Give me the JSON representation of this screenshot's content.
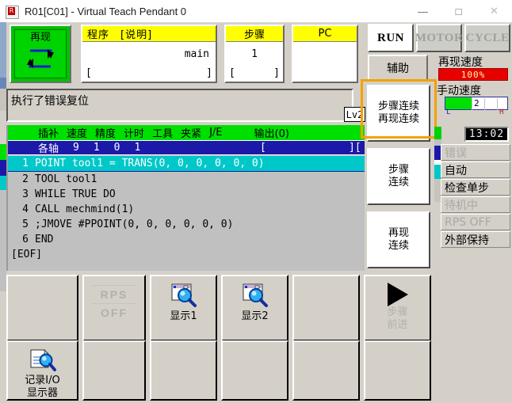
{
  "window": {
    "title": "R01[C01] - Virtual Teach Pendant 0",
    "icon": "robot-app-icon",
    "minimize": "—",
    "maximize": "□",
    "close": "✕"
  },
  "mode_button": {
    "label": "再现",
    "icon": "cycle-arrows-icon",
    "color": "#00c000"
  },
  "panels": {
    "program": {
      "header": "程序　[说明]",
      "value": "main",
      "bracket_left": "[",
      "bracket_right": "]"
    },
    "step": {
      "header": "步骤",
      "value": "1",
      "bracket_left": "[",
      "bracket_right": "]"
    },
    "pc": {
      "header": "PC",
      "value": "",
      "bracket_left": "",
      "bracket_right": ""
    }
  },
  "state_buttons": [
    {
      "label": "RUN",
      "active": true
    },
    {
      "label": "MOTOR",
      "active": false
    },
    {
      "label": "CYCLE",
      "active": false
    }
  ],
  "aux_button": {
    "label": "辅助"
  },
  "speed": {
    "replay_label": "再现速度",
    "replay_value": "100%",
    "replay_color": "#e60000",
    "manual_label": "手动速度",
    "manual_value": "2",
    "manual_color": "#00e000",
    "low_mark": "L",
    "high_mark": "H"
  },
  "clock": {
    "time": "13:02"
  },
  "message_bar": {
    "text": "执行了错误复位",
    "level_badge": "Lv2"
  },
  "code_view": {
    "columns": [
      "插补",
      "速度",
      "精度",
      "计时",
      "工具",
      "夹紧",
      "J/E"
    ],
    "columns_output": "输出(0)",
    "values": [
      "各轴",
      "9",
      "1",
      "0",
      "1"
    ],
    "bracket_1": "[",
    "bracket_2": "][",
    "lines": [
      {
        "no": "1",
        "text": "POINT tool1 = TRANS(0, 0, 0, 0, 0, 0)",
        "selected": true
      },
      {
        "no": "2",
        "text": "TOOL tool1",
        "selected": false
      },
      {
        "no": "3",
        "text": "WHILE TRUE DO",
        "selected": false
      },
      {
        "no": "4",
        "text": "CALL mechmind(1)",
        "selected": false
      },
      {
        "no": "5",
        "text": ";JMOVE #PPOINT(0, 0, 0, 0, 0, 0)",
        "selected": false
      },
      {
        "no": "6",
        "text": "END",
        "selected": false
      }
    ],
    "eof": "[EOF]",
    "selected_color": "#00c8c8",
    "header_color": "#00e000",
    "subheader_color": "#1c18a8"
  },
  "continuous_buttons": [
    {
      "line1": "步骤连续",
      "line2": "再现连续",
      "highlighted": true
    },
    {
      "line1": "步骤",
      "line2": "连续",
      "highlighted": false
    },
    {
      "line1": "再现",
      "line2": "连续",
      "highlighted": false
    }
  ],
  "highlight_color": "#f5a000",
  "status_list": [
    {
      "label": "错误",
      "enabled": false
    },
    {
      "label": "自动",
      "enabled": true
    },
    {
      "label": "检查单步",
      "enabled": true
    },
    {
      "label": "待机中",
      "enabled": false
    },
    {
      "label": "RPS OFF",
      "enabled": false
    },
    {
      "label": "外部保持",
      "enabled": true
    }
  ],
  "function_keys": [
    {
      "id": "key-blank-1",
      "icon": "",
      "line1": "",
      "line2": "",
      "enabled": true
    },
    {
      "id": "key-rps-off",
      "icon": "rps-off-icon",
      "line1": "RPS",
      "line2": "OFF",
      "enabled": false
    },
    {
      "id": "key-display1",
      "icon": "magnifier-screen-icon",
      "line1": "显示1",
      "line2": "",
      "enabled": true
    },
    {
      "id": "key-display2",
      "icon": "magnifier-screen-icon",
      "line1": "显示2",
      "line2": "",
      "enabled": true
    },
    {
      "id": "key-blank-2",
      "icon": "",
      "line1": "",
      "line2": "",
      "enabled": true
    },
    {
      "id": "key-step-fwd",
      "icon": "play-triangle-icon",
      "line1": "步骤",
      "line2": "前进",
      "enabled": false
    },
    {
      "id": "key-io-monitor",
      "icon": "magnifier-doc-icon",
      "line1": "记录I/O",
      "line2": "显示器",
      "enabled": true
    },
    {
      "id": "key-blank-3",
      "icon": "",
      "line1": "",
      "line2": "",
      "enabled": true
    },
    {
      "id": "key-blank-4",
      "icon": "",
      "line1": "",
      "line2": "",
      "enabled": true
    },
    {
      "id": "key-blank-5",
      "icon": "",
      "line1": "",
      "line2": "",
      "enabled": true
    },
    {
      "id": "key-blank-6",
      "icon": "",
      "line1": "",
      "line2": "",
      "enabled": true
    },
    {
      "id": "key-blank-7",
      "icon": "",
      "line1": "",
      "line2": "",
      "enabled": true
    }
  ]
}
